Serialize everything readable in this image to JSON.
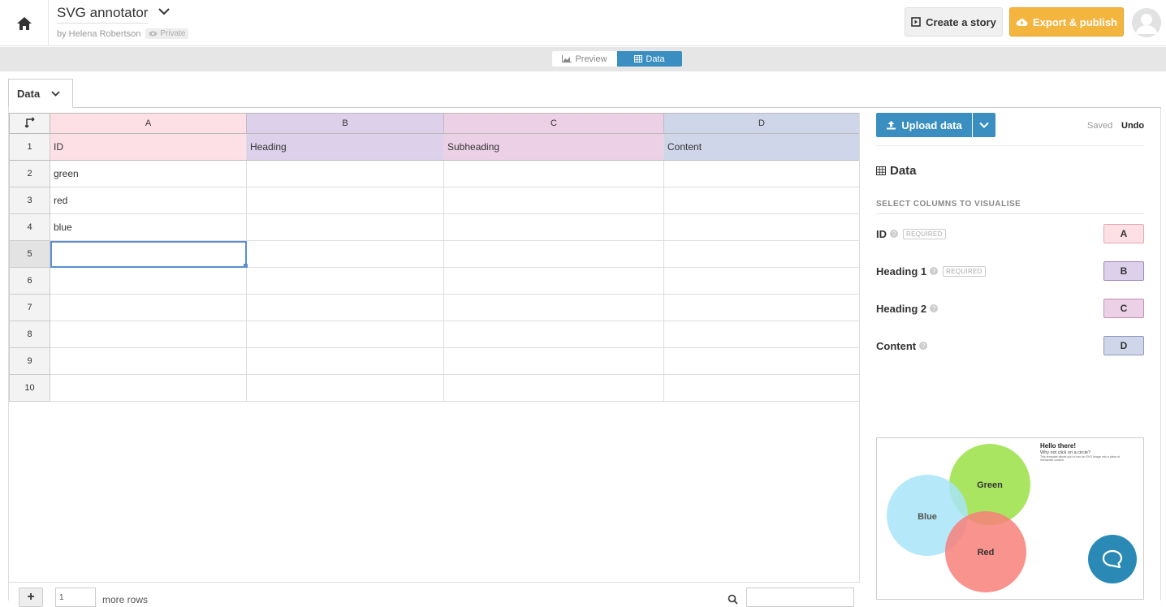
{
  "header": {
    "title": "SVG annotator",
    "byline": "by Helena Robertson",
    "privacy": "Private",
    "create_story": "Create a story",
    "export_publish": "Export & publish"
  },
  "mode": {
    "preview": "Preview",
    "data": "Data"
  },
  "sheet_tab": "Data",
  "grid": {
    "columns": [
      "A",
      "B",
      "C",
      "D"
    ],
    "rows": [
      {
        "num": "1",
        "cells": [
          "ID",
          "Heading",
          "Subheading",
          "Content"
        ]
      },
      {
        "num": "2",
        "cells": [
          "green",
          "",
          "",
          ""
        ]
      },
      {
        "num": "3",
        "cells": [
          "red",
          "",
          "",
          ""
        ]
      },
      {
        "num": "4",
        "cells": [
          "blue",
          "",
          "",
          ""
        ]
      },
      {
        "num": "5",
        "cells": [
          "",
          "",
          "",
          ""
        ]
      },
      {
        "num": "6",
        "cells": [
          "",
          "",
          "",
          ""
        ]
      },
      {
        "num": "7",
        "cells": [
          "",
          "",
          "",
          ""
        ]
      },
      {
        "num": "8",
        "cells": [
          "",
          "",
          "",
          ""
        ]
      },
      {
        "num": "9",
        "cells": [
          "",
          "",
          "",
          ""
        ]
      },
      {
        "num": "10",
        "cells": [
          "",
          "",
          "",
          ""
        ]
      }
    ],
    "add_rows_value": "1",
    "more_rows_label": "more rows"
  },
  "right_panel": {
    "upload": "Upload data",
    "saved": "Saved",
    "undo": "Undo",
    "title": "Data",
    "select_label": "SELECT COLUMNS TO VISUALISE",
    "required": "REQUIRED",
    "mappings": [
      {
        "label": "ID",
        "required": true,
        "column": "A"
      },
      {
        "label": "Heading 1",
        "required": true,
        "column": "B"
      },
      {
        "label": "Heading 2",
        "required": false,
        "column": "C"
      },
      {
        "label": "Content",
        "required": false,
        "column": "D"
      }
    ]
  },
  "thumbnail": {
    "heading": "Hello there!",
    "subheading": "Why not click on a circle?",
    "body": "This template allows you to turn an SVG image into a piece of interactive content",
    "circles": [
      {
        "label": "Green",
        "color": "#9be045"
      },
      {
        "label": "Blue",
        "color": "#a8e4f7"
      },
      {
        "label": "Red",
        "color": "#f7807a"
      }
    ]
  }
}
